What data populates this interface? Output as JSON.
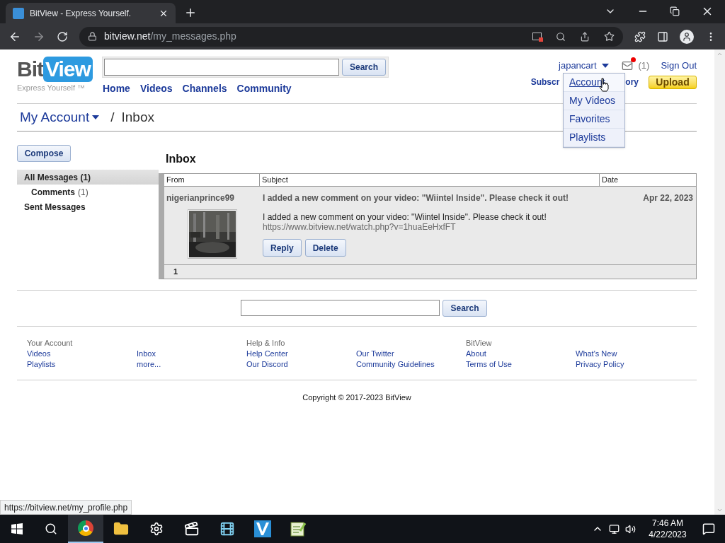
{
  "browser": {
    "tab_title": "BitView - Express Yourself.",
    "url_host": "bitview.net",
    "url_path": "/my_messages.php",
    "status_url": "https://bitview.net/my_profile.php"
  },
  "header": {
    "logo": {
      "bit": "Bit",
      "view": "View",
      "tagline": "Express Yourself ™"
    },
    "search_button": "Search",
    "nav": [
      "Home",
      "Videos",
      "Channels",
      "Community"
    ],
    "user": {
      "name": "japancart",
      "mail_count": "(1)",
      "sign_out": "Sign Out"
    },
    "nav_right": [
      "Subscr",
      "ory"
    ],
    "upload": "Upload",
    "dropdown": [
      {
        "label": "Account",
        "selected": true
      },
      {
        "label": "My Videos",
        "selected": false
      },
      {
        "label": "Favorites",
        "selected": false
      },
      {
        "label": "Playlists",
        "selected": false
      }
    ]
  },
  "breadcrumb": {
    "account": "My Account",
    "separator": "/",
    "current": "Inbox"
  },
  "compose": "Compose",
  "sidebar": [
    {
      "label": "All Messages",
      "count": "(1)",
      "selected": true,
      "children": [
        {
          "label": "Comments",
          "count": "(1)",
          "selected": false
        }
      ]
    },
    {
      "label": "Sent Messages",
      "selected": false
    }
  ],
  "inbox": {
    "title": "Inbox",
    "columns": [
      "From",
      "Subject",
      "Date"
    ],
    "messages": [
      {
        "from": "nigerianprince99",
        "subject": "I added a new comment on your video: \"Wiintel Inside\". Please check it out!",
        "date": "Apr 22, 2023",
        "body": "I added a new comment on your video: \"Wiintel Inside\". Please check it out!",
        "link": "https://www.bitview.net/watch.php?v=1huaEeHxfFT",
        "actions": [
          "Reply",
          "Delete"
        ]
      }
    ],
    "pages": [
      "1"
    ]
  },
  "bottom_search": {
    "button": "Search"
  },
  "footer": [
    {
      "heading": "Your Account",
      "links": [
        [
          "Videos",
          "Playlists"
        ],
        [
          "Inbox",
          "more..."
        ]
      ]
    },
    {
      "heading": "Help & Info",
      "links": [
        [
          "Help Center",
          "Our Discord"
        ],
        [
          "Our Twitter",
          "Community Guidelines"
        ]
      ]
    },
    {
      "heading": "BitView",
      "links": [
        [
          "About",
          "Terms of Use"
        ],
        [
          "What's New",
          "Privacy Policy"
        ]
      ]
    }
  ],
  "copyright": "Copyright © 2017-2023 BitView",
  "taskbar": {
    "time": "7:46 AM",
    "date": "4/22/2023"
  }
}
